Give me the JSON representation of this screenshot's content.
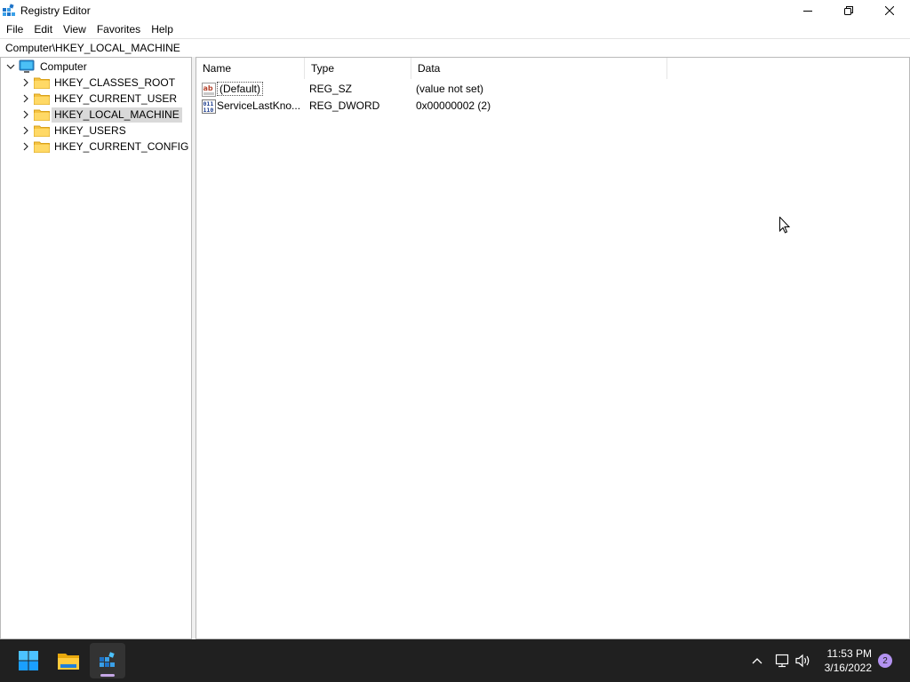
{
  "window": {
    "title": "Registry Editor",
    "caption_icons": [
      "minimize-icon",
      "restore-icon",
      "close-icon"
    ]
  },
  "menu": [
    "File",
    "Edit",
    "View",
    "Favorites",
    "Help"
  ],
  "address": {
    "value": "Computer\\HKEY_LOCAL_MACHINE"
  },
  "tree": {
    "root": "Computer",
    "items": [
      {
        "label": "HKEY_CLASSES_ROOT",
        "selected": false
      },
      {
        "label": "HKEY_CURRENT_USER",
        "selected": false
      },
      {
        "label": "HKEY_LOCAL_MACHINE",
        "selected": true
      },
      {
        "label": "HKEY_USERS",
        "selected": false
      },
      {
        "label": "HKEY_CURRENT_CONFIG",
        "selected": false
      }
    ]
  },
  "list": {
    "columns": [
      "Name",
      "Type",
      "Data"
    ],
    "rows": [
      {
        "icon": "string-value-icon",
        "name": "(Default)",
        "type": "REG_SZ",
        "data": "(value not set)"
      },
      {
        "icon": "dword-value-icon",
        "name": "ServiceLastKno...",
        "type": "REG_DWORD",
        "data": "0x00000002 (2)"
      }
    ]
  },
  "taskbar": {
    "apps": [
      "start-icon",
      "file-explorer-icon",
      "registry-editor-icon"
    ],
    "time": "11:53 PM",
    "date": "3/16/2022",
    "notification_count": "2",
    "accent": "#b392f0"
  }
}
